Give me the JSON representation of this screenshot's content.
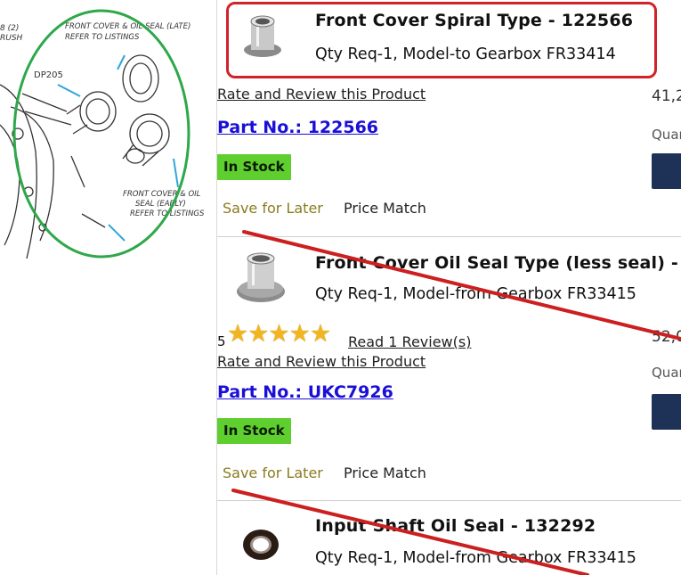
{
  "diagram": {
    "labels": {
      "top_a": "8 (2)",
      "top_b": "RUSH",
      "late_a": "FRONT COVER & OIL SEAL (LATE)",
      "late_b": "REFER TO LISTINGS",
      "dp": "DP205",
      "early_a": "FRONT COVER & OIL",
      "early_b": "SEAL (EARLY)",
      "early_c": "REFER TO LISTINGS"
    },
    "circle_color": "#2ea84a"
  },
  "highlight_color": "#d0222b",
  "products": [
    {
      "title": "Front Cover Spiral Type - 122566",
      "qty": "Qty Req-1, Model-to Gearbox FR33414",
      "rate_link": "Rate and Review this Product",
      "part_no": "Part No.: 122566",
      "stock": "In Stock",
      "save_later": "Save for Later",
      "price_match": "Price Match",
      "price": "41,2",
      "qty_label": "Quan",
      "thumb_icon": "front-cover-part-icon"
    },
    {
      "title": "Front Cover Oil Seal Type (less seal) -",
      "qty": "Qty Req-1, Model-from Gearbox FR33415",
      "rating_count": "5",
      "stars": "★★★★★",
      "rating_value": 5,
      "review_link": "Read 1 Review(s)",
      "rate_link": "Rate and Review this Product",
      "part_no": "Part No.: UKC7926",
      "stock": "In Stock",
      "save_later": "Save for Later",
      "price_match": "Price Match",
      "price": "52,0",
      "qty_label": "Quan",
      "thumb_icon": "front-cover-part-icon"
    },
    {
      "title": "Input Shaft Oil Seal - 132292",
      "qty": "Qty Req-1, Model-from Gearbox FR33415",
      "thumb_icon": "oil-seal-icon"
    }
  ],
  "colors": {
    "part_link": "#1a0fd6",
    "stock_badge": "#5fce2f",
    "save_later": "#8b7b1e",
    "cart_button": "#1e3258",
    "stars": "#f2b51f",
    "strike_lines": "#cc1f1f"
  }
}
